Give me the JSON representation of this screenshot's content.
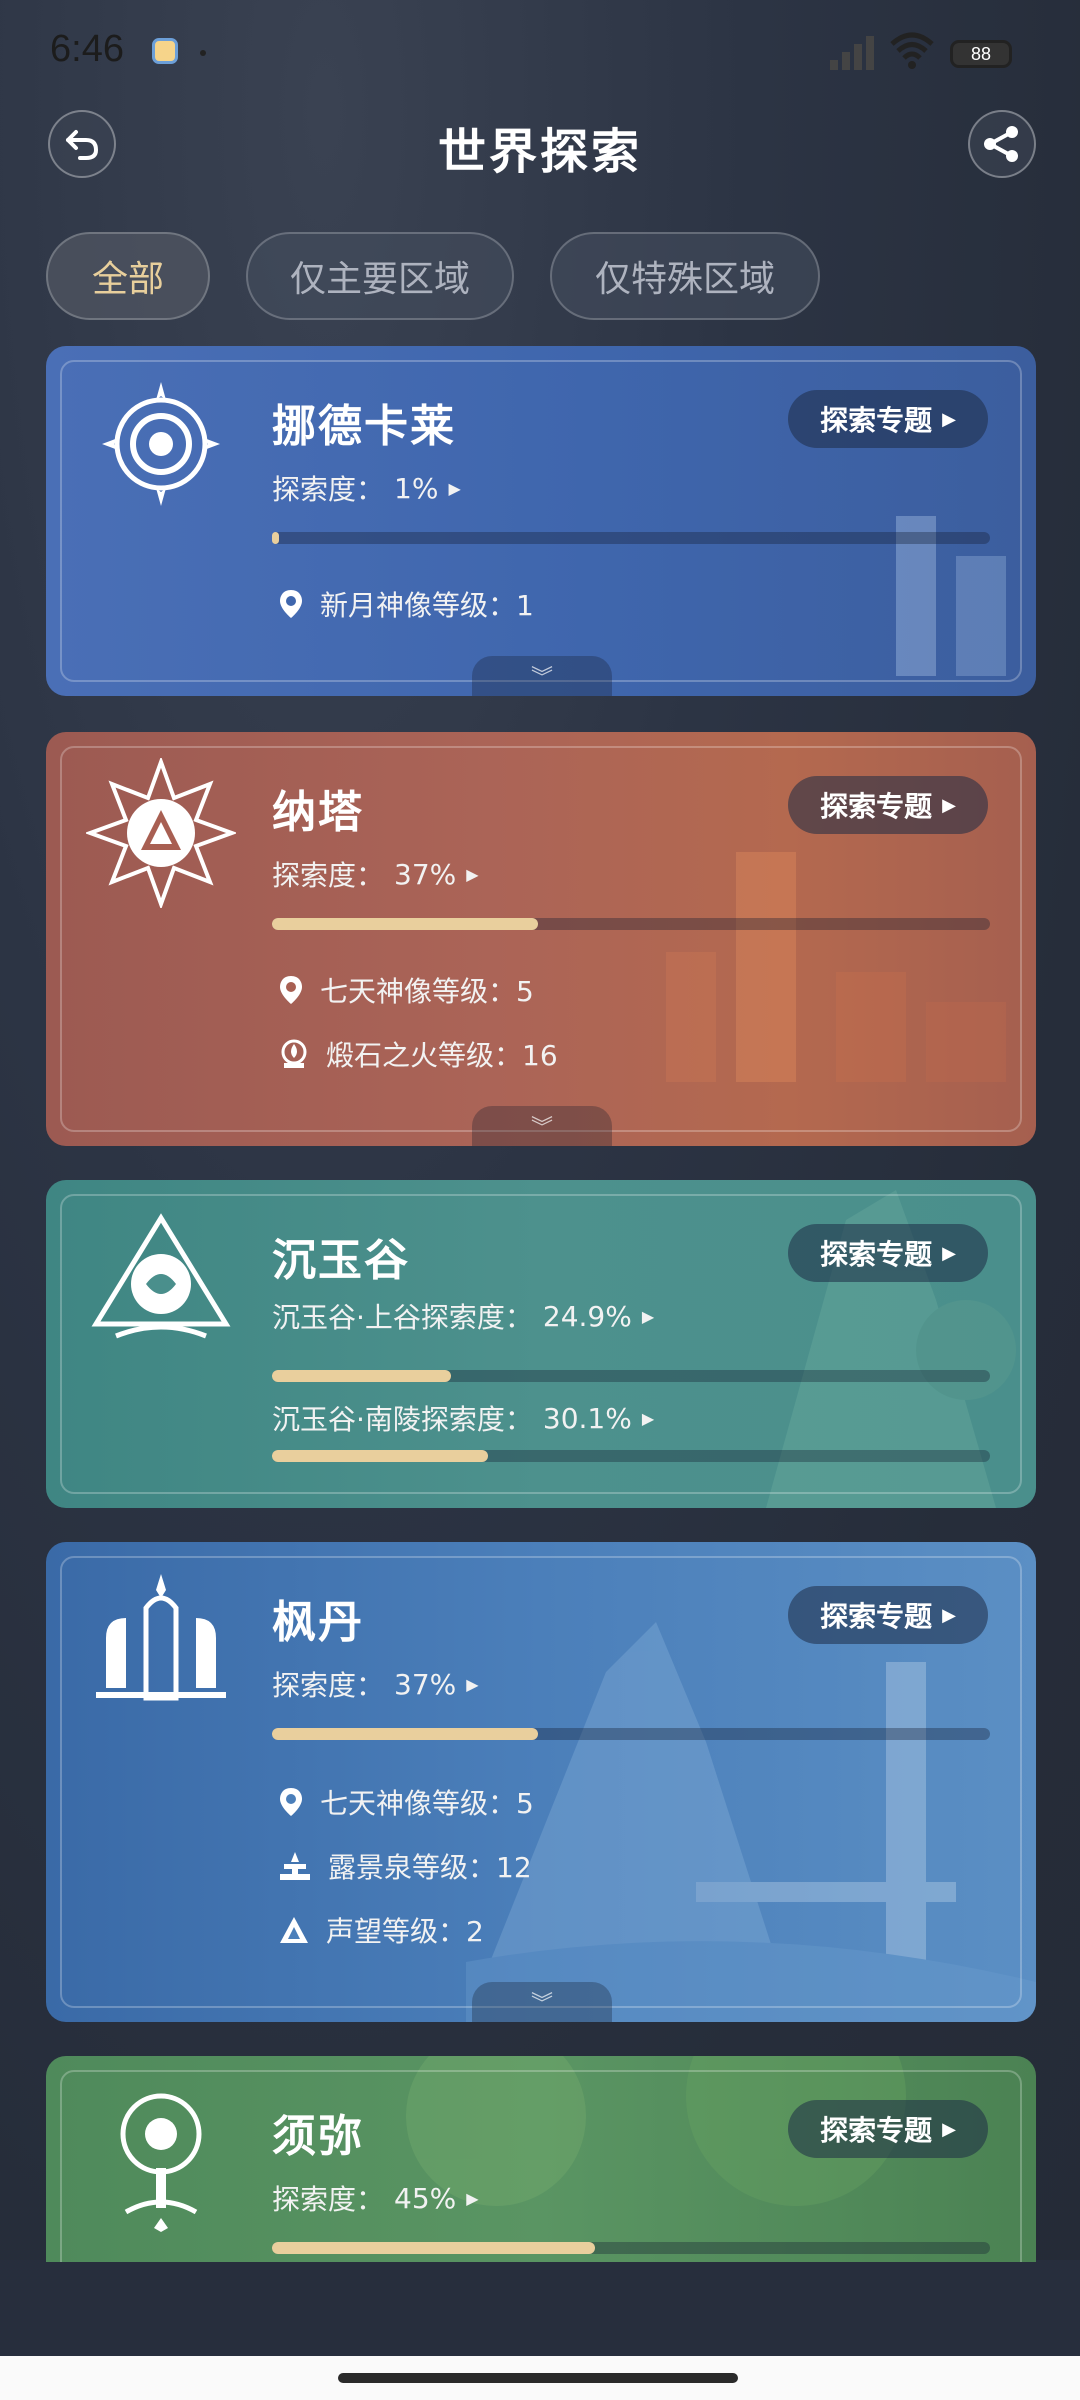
{
  "status_bar": {
    "time": "6:46",
    "battery": "88"
  },
  "header": {
    "title": "世界探索"
  },
  "filters": [
    {
      "label": "全部",
      "active": true
    },
    {
      "label": "仅主要区域",
      "active": false
    },
    {
      "label": "仅特殊区域",
      "active": false
    }
  ],
  "regions": [
    {
      "name": "挪德卡莱",
      "topic_label": "探索专题",
      "progress": [
        {
          "label": "探索度：",
          "value": "1%",
          "percent": 1
        }
      ],
      "stats": [
        {
          "icon": "statue-pin-icon",
          "text": "新月神像等级：1"
        }
      ]
    },
    {
      "name": "纳塔",
      "topic_label": "探索专题",
      "progress": [
        {
          "label": "探索度：",
          "value": "37%",
          "percent": 37
        }
      ],
      "stats": [
        {
          "icon": "statue-pin-icon",
          "text": "七天神像等级：5"
        },
        {
          "icon": "flame-altar-icon",
          "text": "煅石之火等级：16"
        }
      ]
    },
    {
      "name": "沉玉谷",
      "topic_label": "探索专题",
      "progress": [
        {
          "label": "沉玉谷·上谷探索度：",
          "value": "24.9%",
          "percent": 24.9
        },
        {
          "label": "沉玉谷·南陵探索度：",
          "value": "30.1%",
          "percent": 30.1
        }
      ],
      "stats": []
    },
    {
      "name": "枫丹",
      "topic_label": "探索专题",
      "progress": [
        {
          "label": "探索度：",
          "value": "37%",
          "percent": 37
        }
      ],
      "stats": [
        {
          "icon": "statue-pin-icon",
          "text": "七天神像等级：5"
        },
        {
          "icon": "fountain-icon",
          "text": "露景泉等级：12"
        },
        {
          "icon": "reputation-icon",
          "text": "声望等级：2"
        }
      ]
    },
    {
      "name": "须弥",
      "topic_label": "探索专题",
      "progress": [
        {
          "label": "探索度：",
          "value": "45%",
          "percent": 45
        }
      ],
      "stats": []
    }
  ]
}
